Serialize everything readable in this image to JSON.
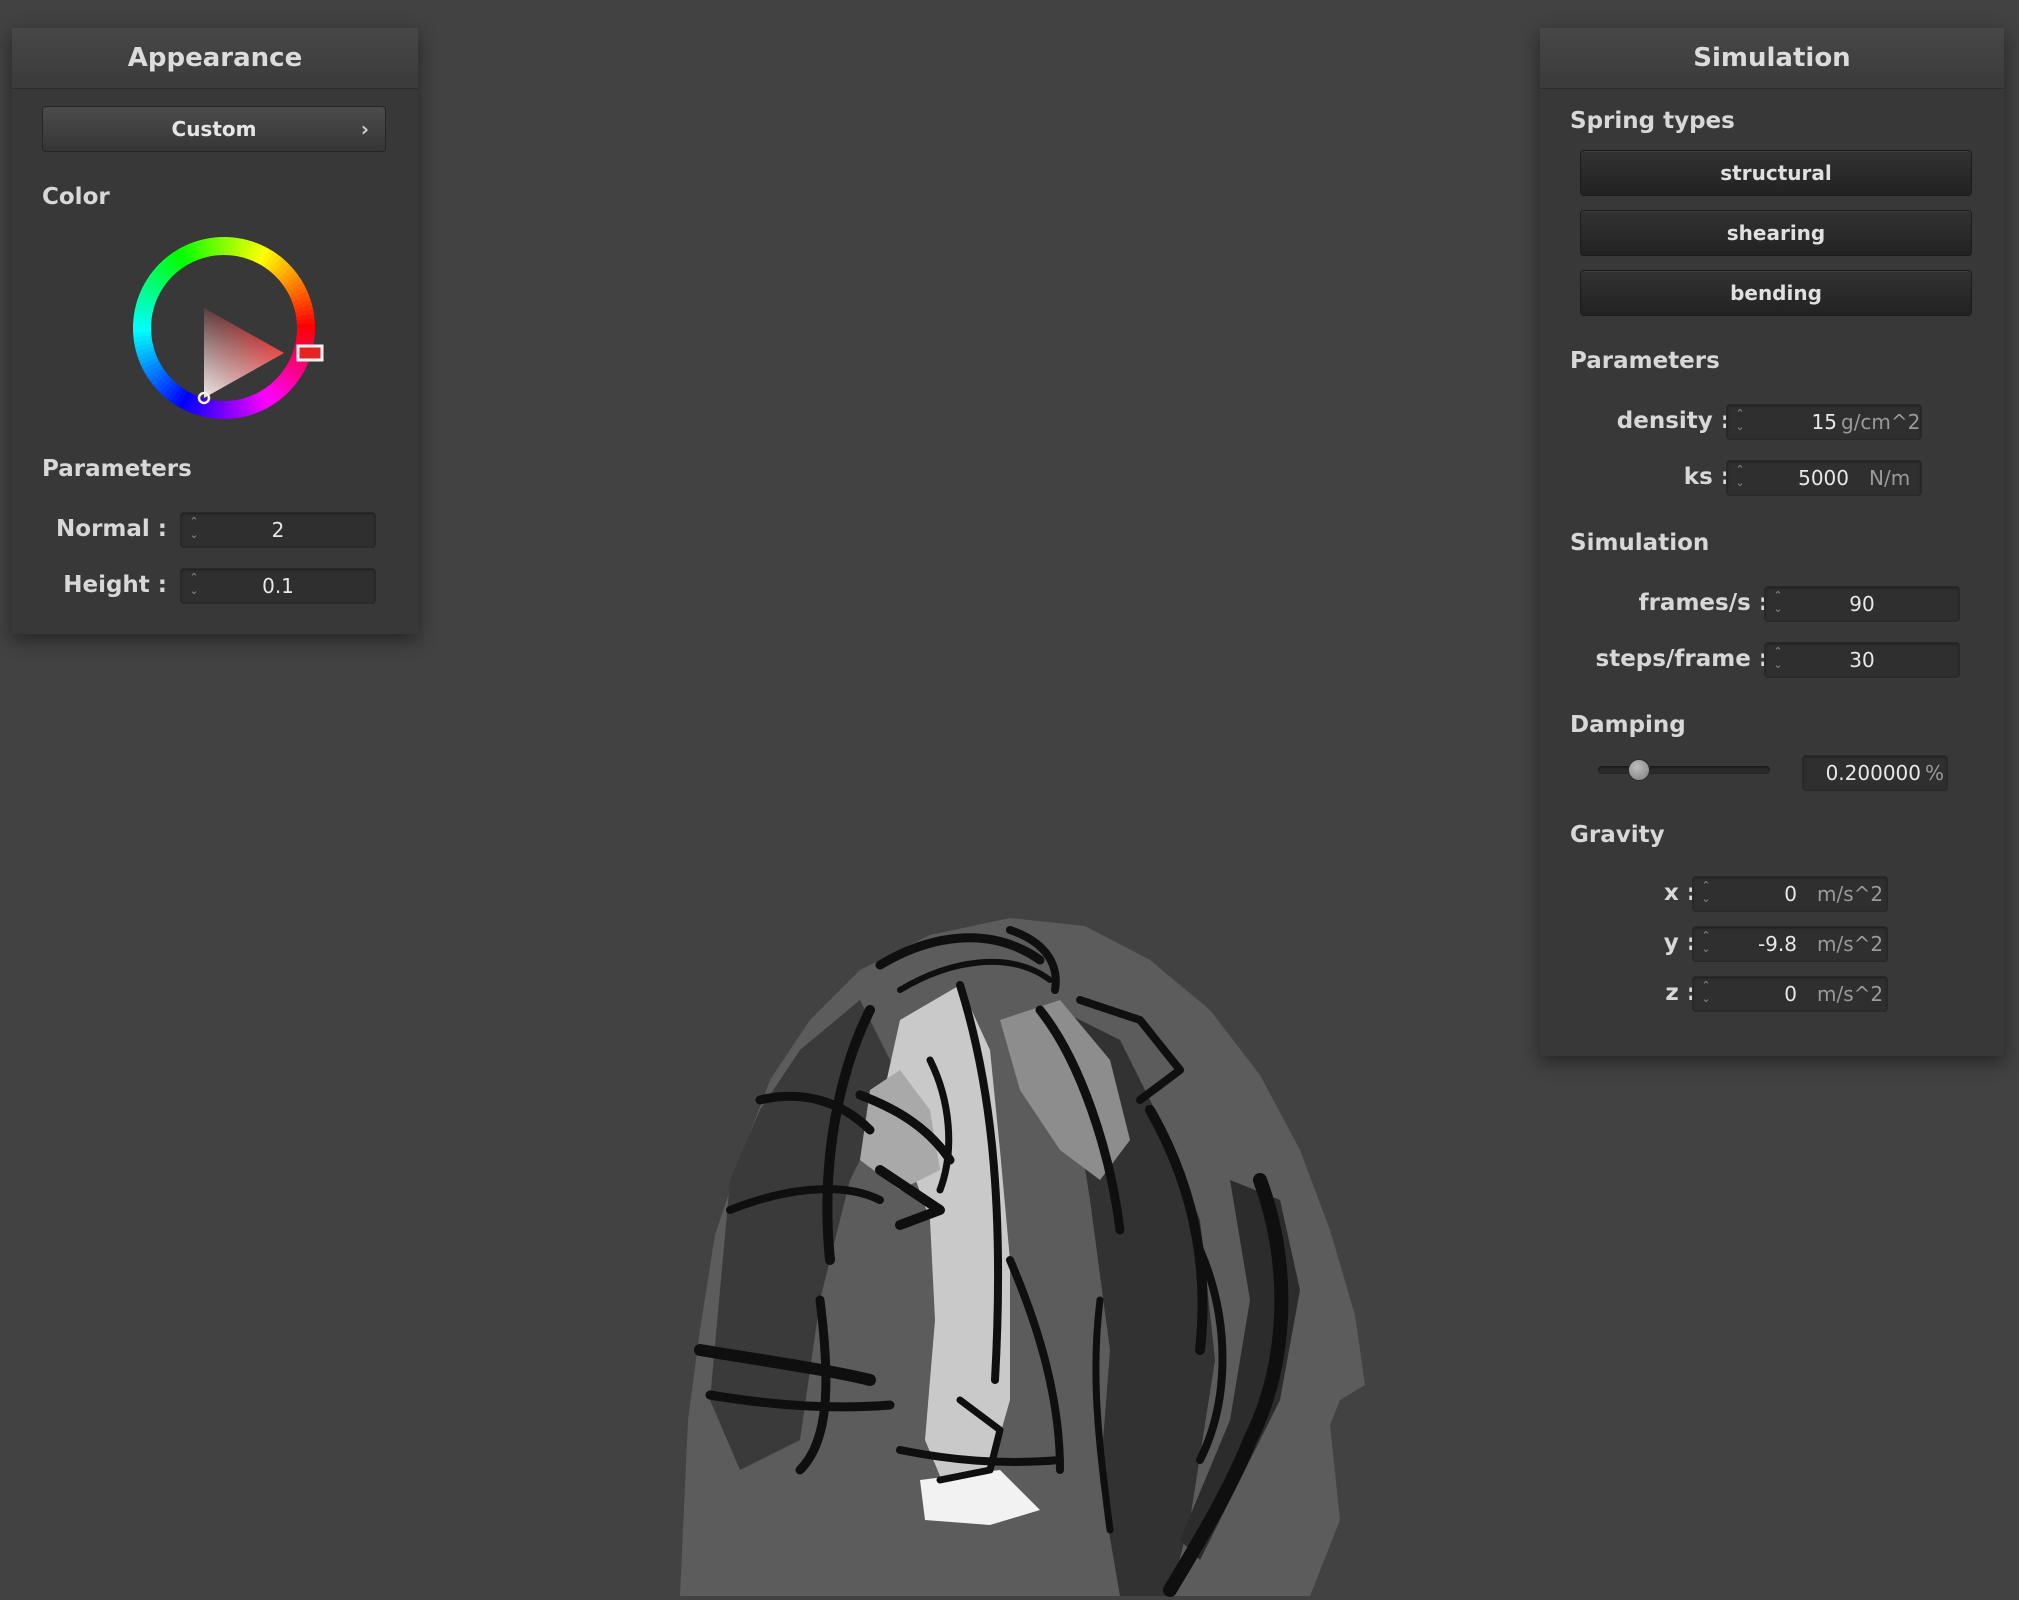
{
  "appearance": {
    "title": "Appearance",
    "preset_button": "Custom",
    "preset_chevron": "›",
    "color_label": "Color",
    "selected_color": "#e52323",
    "parameters_label": "Parameters",
    "normal": {
      "label": "Normal :",
      "value": "2"
    },
    "height": {
      "label": "Height :",
      "value": "0.1"
    }
  },
  "simulation_panel": {
    "title": "Simulation",
    "spring_types_label": "Spring types",
    "spring_types": [
      "structural",
      "shearing",
      "bending"
    ],
    "parameters_label": "Parameters",
    "density": {
      "label": "density :",
      "value": "15",
      "unit": "g/cm^2"
    },
    "ks": {
      "label": "ks :",
      "value": "5000",
      "unit": "N/m"
    },
    "simulation_label": "Simulation",
    "frames_per_s": {
      "label": "frames/s :",
      "value": "90"
    },
    "steps_per_frame": {
      "label": "steps/frame :",
      "value": "30"
    },
    "damping_label": "Damping",
    "damping": {
      "value": "0.200000",
      "unit": "%",
      "slider_level": 0.2
    },
    "gravity_label": "Gravity",
    "gravity": [
      {
        "label": "x :",
        "value": "0",
        "unit": "m/s^2"
      },
      {
        "label": "y :",
        "value": "-9.8",
        "unit": "m/s^2"
      },
      {
        "label": "z :",
        "value": "0",
        "unit": "m/s^2"
      }
    ]
  },
  "icons": {
    "spin_arrows": "⌃⌄",
    "color_wheel": "color-wheel-icon"
  },
  "colors": {
    "background": "#424242",
    "panel": "#383838",
    "cloth_base": "#5a5a5a"
  }
}
